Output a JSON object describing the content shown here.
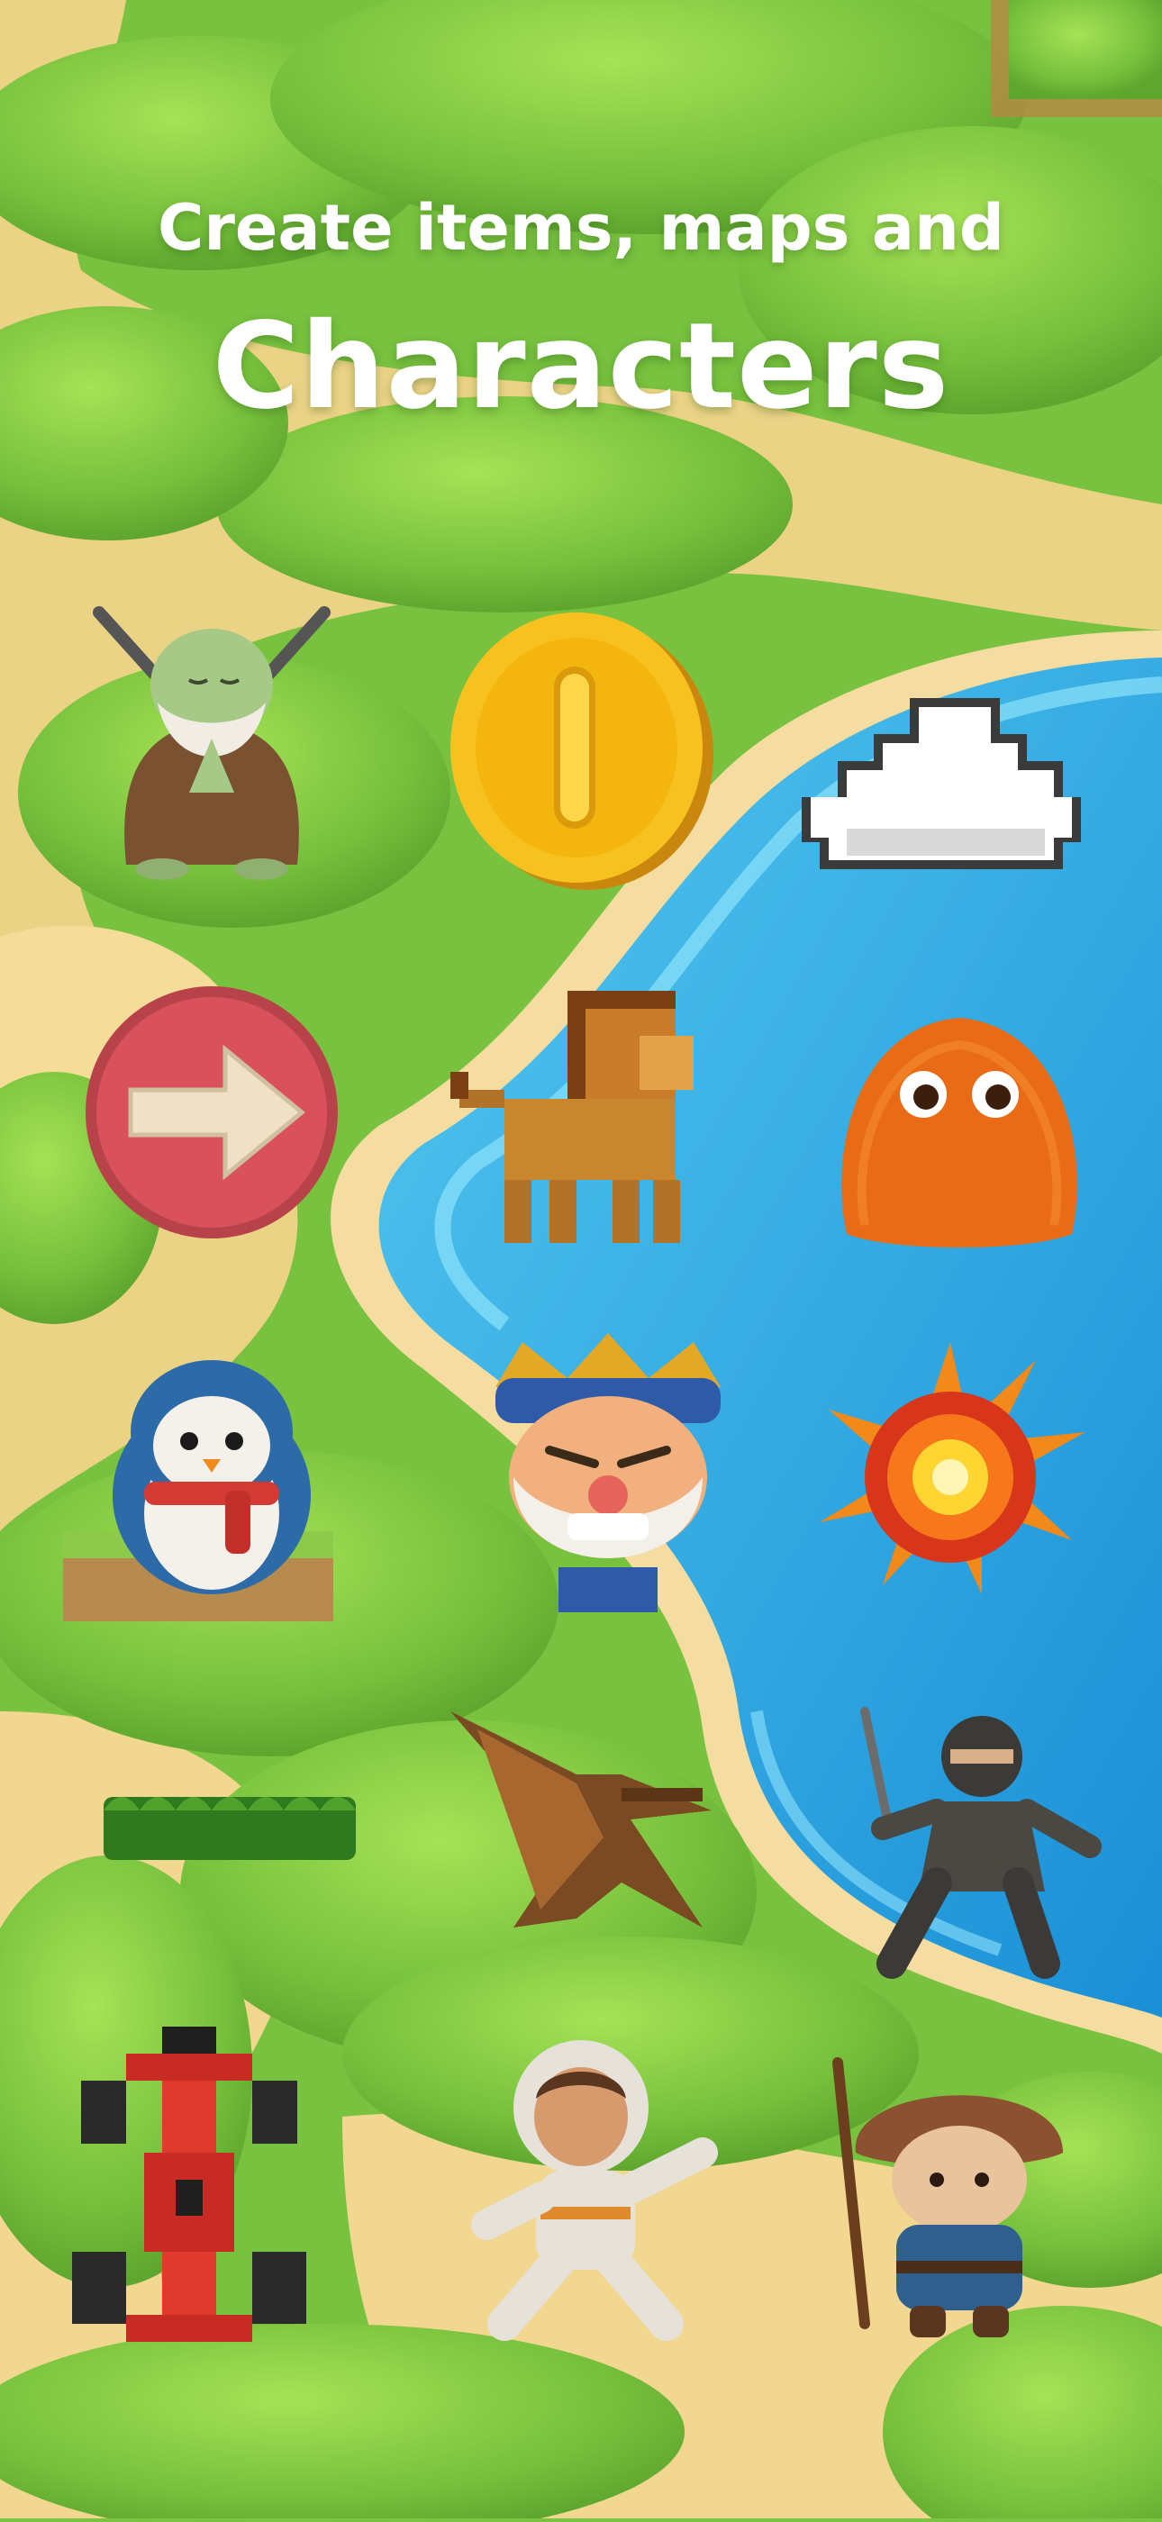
{
  "headline": {
    "line1": "Create items, maps and",
    "line2": "Characters"
  },
  "colors": {
    "grass": "#7bc342",
    "grass_light": "#9ad94f",
    "path_sand": "#f2d790",
    "water": "#2ea7e0",
    "water_light": "#5fd0f2",
    "text": "#ffffff"
  },
  "items": [
    {
      "icon": "monk-warrior-icon"
    },
    {
      "icon": "gold-coin-icon"
    },
    {
      "icon": "pixel-cloud-icon"
    },
    {
      "icon": "knitted-arrow-button-icon"
    },
    {
      "icon": "pixel-lion-icon"
    },
    {
      "icon": "orange-fuzzy-monster-icon"
    },
    {
      "icon": "penguin-icon"
    },
    {
      "icon": "bearded-king-icon"
    },
    {
      "icon": "explosion-icon"
    },
    {
      "icon": "leafy-platform-icon"
    },
    {
      "icon": "pixel-pterodactyl-icon"
    },
    {
      "icon": "ninja-icon"
    },
    {
      "icon": "pixel-race-car-icon"
    },
    {
      "icon": "astronaut-kid-icon"
    },
    {
      "icon": "mushroom-wanderer-icon"
    }
  ]
}
